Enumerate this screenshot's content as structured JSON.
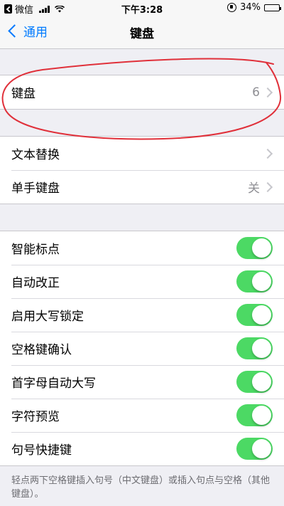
{
  "status_bar": {
    "carrier": "微信",
    "time": "下午3:28",
    "battery": "34%",
    "battery_level": 0.34
  },
  "nav": {
    "back_label": "通用",
    "title": "键盘"
  },
  "group1": {
    "keyboards_label": "键盘",
    "keyboards_value": "6"
  },
  "group2": {
    "text_replacement_label": "文本替换",
    "one_handed_label": "单手键盘",
    "one_handed_value": "关"
  },
  "toggles": [
    {
      "label": "智能标点",
      "on": true
    },
    {
      "label": "自动改正",
      "on": true
    },
    {
      "label": "启用大写锁定",
      "on": true
    },
    {
      "label": "空格键确认",
      "on": true
    },
    {
      "label": "首字母自动大写",
      "on": true
    },
    {
      "label": "字符预览",
      "on": true
    },
    {
      "label": "句号快捷键",
      "on": true
    }
  ],
  "footer": "轻点两下空格键插入句号（中文键盘）或插入句点与空格（其他键盘）。",
  "colors": {
    "accent": "#007aff",
    "toggle_on": "#4cd964",
    "annotation": "#e0303a"
  }
}
